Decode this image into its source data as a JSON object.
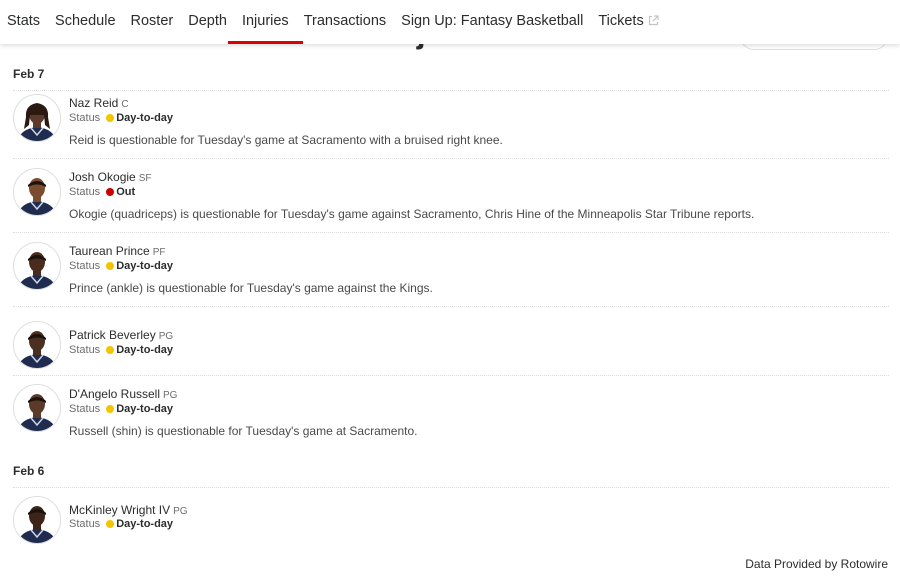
{
  "nav": {
    "items": [
      {
        "label": "Stats",
        "active": false
      },
      {
        "label": "Schedule",
        "active": false
      },
      {
        "label": "Roster",
        "active": false
      },
      {
        "label": "Depth",
        "active": false
      },
      {
        "label": "Injuries",
        "active": true
      },
      {
        "label": "Transactions",
        "active": false
      },
      {
        "label": "Sign Up: Fantasy Basketball",
        "active": false
      },
      {
        "label": "Tickets",
        "active": false,
        "external": true
      }
    ]
  },
  "page": {
    "title_partial": "Minnesota Timberwolves Injuries"
  },
  "colors": {
    "accent": "#dd0000",
    "day_to_day": "#f5c400",
    "out": "#cc0000"
  },
  "groups": [
    {
      "date": "Feb 7",
      "players": [
        {
          "name": "Naz Reid",
          "pos": "C",
          "status_label": "Status",
          "status": "Day-to-day",
          "status_color": "#f5c400",
          "desc": "Reid is questionable for Tuesday's game at Sacramento with a bruised right knee.",
          "skin": "#5a3a2a",
          "hair": "dreads"
        },
        {
          "name": "Josh Okogie",
          "pos": "SF",
          "status_label": "Status",
          "status": "Out",
          "status_color": "#cc0000",
          "desc": "Okogie (quadriceps) is questionable for Tuesday's game against Sacramento, Chris Hine of the Minneapolis Star Tribune reports.",
          "skin": "#7a4c30",
          "hair": "short"
        },
        {
          "name": "Taurean Prince",
          "pos": "PF",
          "status_label": "Status",
          "status": "Day-to-day",
          "status_color": "#f5c400",
          "desc": "Prince (ankle) is questionable for Tuesday's game against the Kings.",
          "skin": "#4a2c1e",
          "hair": "short"
        },
        {
          "name": "Patrick Beverley",
          "pos": "PG",
          "status_label": "Status",
          "status": "Day-to-day",
          "status_color": "#f5c400",
          "desc": "",
          "skin": "#4b2f20",
          "hair": "short"
        },
        {
          "name": "D'Angelo Russell",
          "pos": "PG",
          "status_label": "Status",
          "status": "Day-to-day",
          "status_color": "#f5c400",
          "desc": "Russell (shin) is questionable for Tuesday's game at Sacramento.",
          "skin": "#5b3a28",
          "hair": "short"
        }
      ]
    },
    {
      "date": "Feb 6",
      "players": [
        {
          "name": "McKinley Wright IV",
          "pos": "PG",
          "status_label": "Status",
          "status": "Day-to-day",
          "status_color": "#f5c400",
          "desc": "",
          "skin": "#3e2418",
          "hair": "short"
        }
      ]
    }
  ],
  "footer": {
    "credit": "Data Provided by Rotowire"
  }
}
